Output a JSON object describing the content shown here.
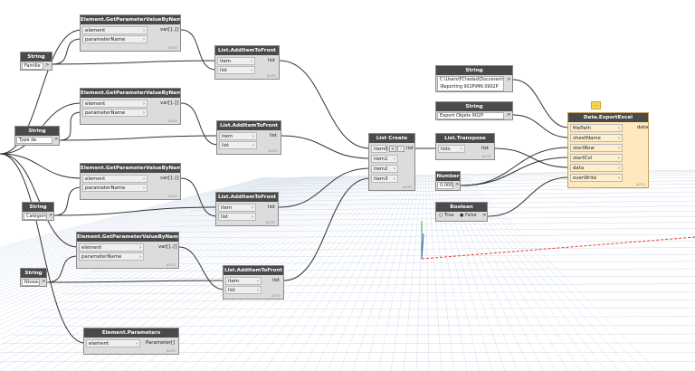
{
  "nodes": {
    "gp1": {
      "title": "Element.GetParameterValueByName",
      "in": [
        "element",
        "parameterName"
      ],
      "out": "var[]..[]",
      "auto": "AUTO"
    },
    "gp2": {
      "title": "Element.GetParameterValueByName",
      "in": [
        "element",
        "parameterName"
      ],
      "out": "var[]..[]",
      "auto": "AUTO"
    },
    "gp3": {
      "title": "Element.GetParameterValueByName",
      "in": [
        "element",
        "parameterName"
      ],
      "out": "var[]..[]",
      "auto": "AUTO"
    },
    "gp4": {
      "title": "Element.GetParameterValueByName",
      "in": [
        "element",
        "parameterName"
      ],
      "out": "var[]..[]",
      "auto": "AUTO"
    },
    "ep": {
      "title": "Element.Parameters",
      "in": [
        "element"
      ],
      "out": "Parameter[]",
      "auto": "AUTO"
    },
    "s1": {
      "title": "String",
      "value": "Famille",
      "out": ">"
    },
    "s2": {
      "title": "String",
      "value": "Type de famille",
      "out": ">"
    },
    "s3": {
      "title": "String",
      "value": "Catégorie",
      "out": ">"
    },
    "s4": {
      "title": "String",
      "value": "Niveau",
      "out": ">"
    },
    "af1": {
      "title": "List.AddItemToFront",
      "in": [
        "item",
        "list"
      ],
      "out": "list",
      "auto": "AUTO"
    },
    "af2": {
      "title": "List.AddItemToFront",
      "in": [
        "item",
        "list"
      ],
      "out": "list",
      "auto": "AUTO"
    },
    "af3": {
      "title": "List.AddItemToFront",
      "in": [
        "item",
        "list"
      ],
      "out": "list",
      "auto": "AUTO"
    },
    "af4": {
      "title": "List.AddItemToFront",
      "in": [
        "item",
        "list"
      ],
      "out": "list",
      "auto": "AUTO"
    },
    "lc": {
      "title": "List Create",
      "in": [
        "item0",
        "item1",
        "item2",
        "item3"
      ],
      "plus": "+",
      "minus": "-",
      "out": "list",
      "auto": "AUTO"
    },
    "lt": {
      "title": "List.Transpose",
      "in": [
        "lists"
      ],
      "out": "list",
      "auto": "AUTO"
    },
    "path": {
      "title": "String",
      "value_line1": "C:\\Users\\FChedad\\Documents",
      "value_line2": "\\Reporting 902P\\MN 0902P",
      "out": ">"
    },
    "sheet": {
      "title": "String",
      "value": "Export Objets 902P",
      "out": ">"
    },
    "num": {
      "title": "Number",
      "value": "0.000",
      "out": ">"
    },
    "bool": {
      "title": "Boolean",
      "opt_true": "True",
      "opt_false": "False",
      "out": ">"
    },
    "dx": {
      "title": "Data.ExportExcel",
      "in": [
        "filePath",
        "sheetName",
        "startRow",
        "startCol",
        "data",
        "overWrite"
      ],
      "out": "data",
      "auto": "AUTO",
      "warning": "..."
    }
  },
  "colors": {
    "header": "#4a4a4a",
    "node_body": "#dcdcdc",
    "selected_body": "#fde9bd",
    "wire": "#333333",
    "grid": "#c9d6e6",
    "axis_x": "#e23b3b",
    "axis_y": "#2aa84a",
    "axis_z": "#3b56e2"
  }
}
